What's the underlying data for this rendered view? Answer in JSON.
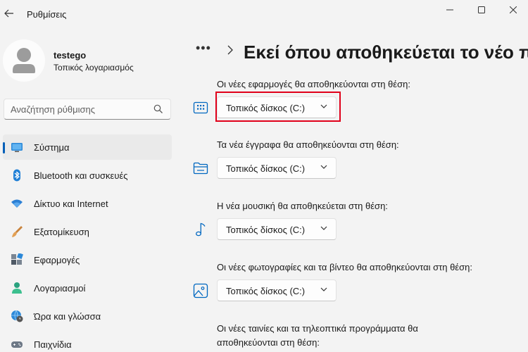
{
  "window": {
    "title": "Ρυθμίσεις"
  },
  "profile": {
    "name": "testego",
    "account_type": "Τοπικός λογαριασμός"
  },
  "search": {
    "placeholder": "Αναζήτηση ρύθμισης"
  },
  "nav": {
    "items": [
      {
        "label": "Σύστημα",
        "icon": "system-icon",
        "active": true
      },
      {
        "label": "Bluetooth και συσκευές",
        "icon": "bluetooth-icon"
      },
      {
        "label": "Δίκτυο και Internet",
        "icon": "wifi-icon"
      },
      {
        "label": "Εξατομίκευση",
        "icon": "brush-icon"
      },
      {
        "label": "Εφαρμογές",
        "icon": "apps-icon"
      },
      {
        "label": "Λογαριασμοί",
        "icon": "person-icon"
      },
      {
        "label": "Ώρα και γλώσσα",
        "icon": "globe-clock-icon"
      },
      {
        "label": "Παιχνίδια",
        "icon": "gamepad-icon"
      }
    ]
  },
  "breadcrumb": {
    "more": "•••",
    "title": "Εκεί όπου αποθηκεύεται το νέο περιεχόμενο"
  },
  "settings": [
    {
      "label": "Οι νέες εφαρμογές θα αποθηκεύονται στη θέση:",
      "value": "Τοπικός δίσκος (C:)",
      "icon": "apps-storage-icon"
    },
    {
      "label": "Τα νέα έγγραφα θα αποθηκεύονται στη θέση:",
      "value": "Τοπικός δίσκος (C:)",
      "icon": "folder-icon"
    },
    {
      "label": "Η νέα μουσική θα αποθηκεύεται στη θέση:",
      "value": "Τοπικός δίσκος (C:)",
      "icon": "music-note-icon"
    },
    {
      "label": "Οι νέες φωτογραφίες και τα βίντεο θα αποθηκεύονται στη θέση:",
      "value": "Τοπικός δίσκος (C:)",
      "icon": "image-icon"
    },
    {
      "label_line1": "Οι νέες ταινίες και τα τηλεοπτικά προγράμματα θα",
      "label_line2": "αποθηκεύονται στη θέση:"
    }
  ],
  "colors": {
    "accent": "#005fb8",
    "highlight": "#e0001a",
    "background": "#f3f3f3"
  }
}
